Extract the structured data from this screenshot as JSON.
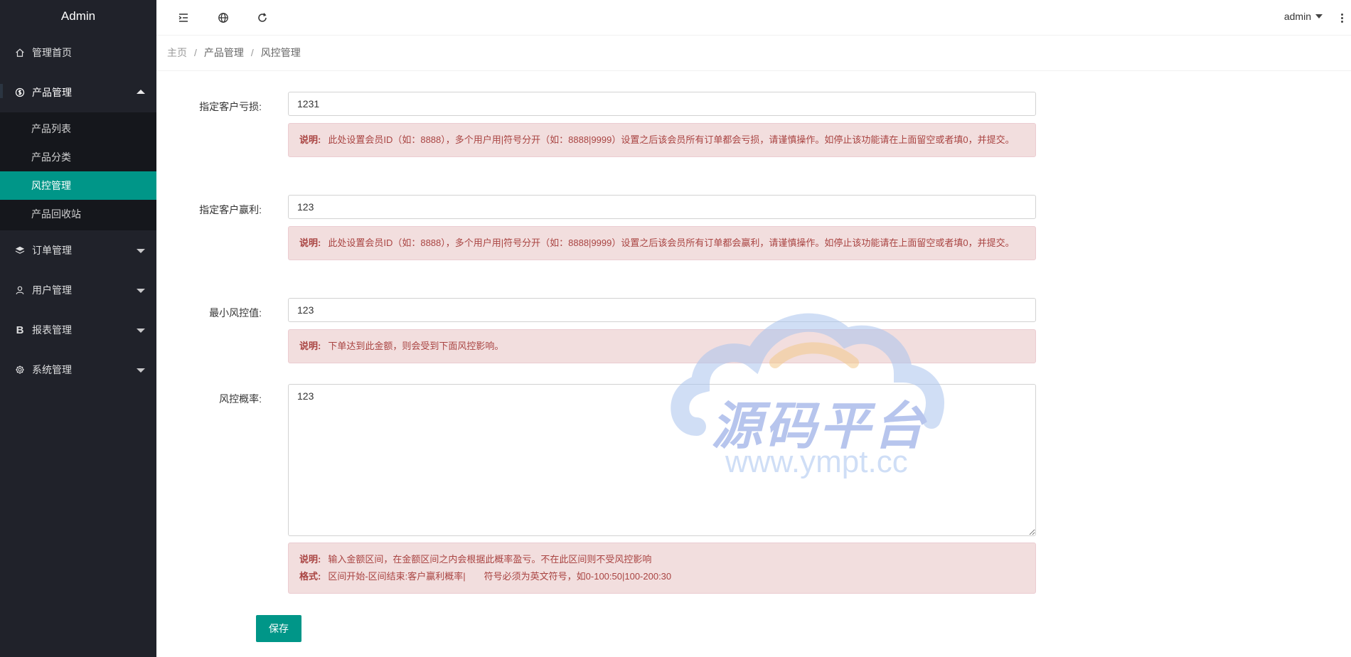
{
  "app": {
    "title": "Admin"
  },
  "sidebar": {
    "items": [
      {
        "label": "管理首页",
        "icon": "home-icon"
      },
      {
        "label": "产品管理",
        "icon": "dollar-circle-icon",
        "open": true,
        "children": [
          {
            "label": "产品列表"
          },
          {
            "label": "产品分类"
          },
          {
            "label": "风控管理",
            "active": true
          },
          {
            "label": "产品回收站"
          }
        ]
      },
      {
        "label": "订单管理",
        "icon": "layers-icon"
      },
      {
        "label": "用户管理",
        "icon": "user-icon"
      },
      {
        "label": "报表管理",
        "icon": "bold-b-icon"
      },
      {
        "label": "系统管理",
        "icon": "gear-icon"
      }
    ]
  },
  "header": {
    "user": "admin"
  },
  "breadcrumb": {
    "home": "主页",
    "parent": "产品管理",
    "current": "风控管理",
    "separator": "/"
  },
  "form": {
    "loss": {
      "label": "指定客户亏损:",
      "value": "1231",
      "note_title": "说明:",
      "note": "此处设置会员ID（如：8888），多个用户用|符号分开（如：8888|9999）设置之后该会员所有订单都会亏损，请谨慎操作。如停止该功能请在上面留空或者填0，并提交。"
    },
    "profit": {
      "label": "指定客户赢利:",
      "value": "123",
      "note_title": "说明:",
      "note": "此处设置会员ID（如：8888），多个用户用|符号分开（如：8888|9999）设置之后该会员所有订单都会赢利，请谨慎操作。如停止该功能请在上面留空或者填0，并提交。"
    },
    "min": {
      "label": "最小风控值:",
      "value": "123",
      "note_title": "说明:",
      "note": "下单达到此金额，则会受到下面风控影响。"
    },
    "rate": {
      "label": "风控概率:",
      "value": "123",
      "note_title": "说明:",
      "note": "输入金额区间，在金额区间之内会根据此概率盈亏。不在此区间则不受风控影响",
      "format_title": "格式:",
      "format": "区间开始-区间结束:客户赢利概率|　　符号必须为英文符号，如0-100:50|100-200:30"
    },
    "save_label": "保存"
  },
  "watermark": {
    "text": "源码平台",
    "url": "www.ympt.cc"
  },
  "colors": {
    "accent": "#009688",
    "sidebar": "#20222a",
    "alert_bg": "#f2dede",
    "alert_text": "#a94442"
  }
}
